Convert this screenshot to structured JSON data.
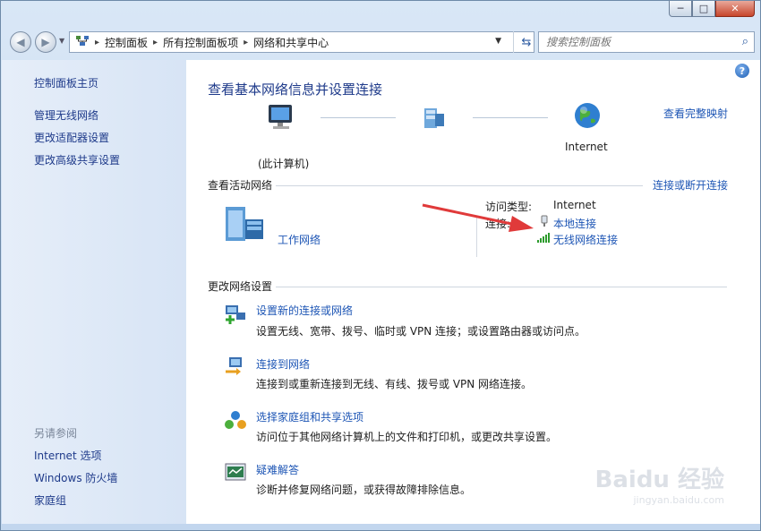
{
  "window": {
    "minimize_label": "─",
    "maximize_label": "□",
    "close_label": "✕"
  },
  "address": {
    "crumbs": [
      "控制面板",
      "所有控制面板项",
      "网络和共享中心"
    ],
    "search_placeholder": "搜索控制面板"
  },
  "sidebar": {
    "home": "控制面板主页",
    "items": [
      "管理无线网络",
      "更改适配器设置",
      "更改高级共享设置"
    ],
    "see_also_heading": "另请参阅",
    "see_also": [
      "Internet 选项",
      "Windows 防火墙",
      "家庭组"
    ]
  },
  "main": {
    "title": "查看基本网络信息并设置连接",
    "view_full_map": "查看完整映射",
    "map": {
      "this_computer": "(此计算机)",
      "internet": "Internet"
    },
    "active_networks_heading": "查看活动网络",
    "connect_disconnect": "连接或断开连接",
    "network_name": "工作网络",
    "access_type_label": "访问类型:",
    "access_type_value": "Internet",
    "connections_label": "连接:",
    "connections": [
      "本地连接",
      "无线网络连接"
    ],
    "change_settings_heading": "更改网络设置",
    "tasks": [
      {
        "title": "设置新的连接或网络",
        "desc": "设置无线、宽带、拨号、临时或 VPN 连接；或设置路由器或访问点。"
      },
      {
        "title": "连接到网络",
        "desc": "连接到或重新连接到无线、有线、拨号或 VPN 网络连接。"
      },
      {
        "title": "选择家庭组和共享选项",
        "desc": "访问位于其他网络计算机上的文件和打印机，或更改共享设置。"
      },
      {
        "title": "疑难解答",
        "desc": "诊断并修复网络问题，或获得故障排除信息。"
      }
    ]
  },
  "watermark": {
    "brand": "Baidu 经验",
    "url": "jingyan.baidu.com"
  },
  "colors": {
    "link": "#1e56b5",
    "title": "#1e3a8a",
    "arrow": "#e03a3a"
  }
}
